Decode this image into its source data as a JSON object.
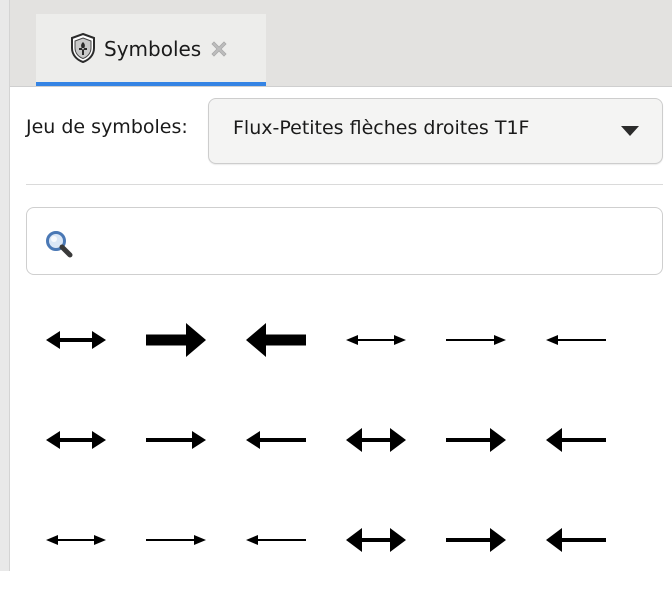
{
  "tab": {
    "label": "Symboles",
    "icon": "shield-icon",
    "close_icon": "close-icon",
    "accent_color": "#3584e4"
  },
  "symbol_set": {
    "label": "Jeu de symboles:",
    "selected": "Flux-Petites flèches droites T1F"
  },
  "search": {
    "value": "",
    "placeholder": "",
    "icon": "search-icon"
  },
  "symbols": [
    {
      "icon": "double-arrow-icon",
      "style": "bold"
    },
    {
      "icon": "arrow-right-icon",
      "style": "heavy"
    },
    {
      "icon": "arrow-left-icon",
      "style": "heavy"
    },
    {
      "icon": "double-arrow-icon",
      "style": "thin"
    },
    {
      "icon": "arrow-right-icon",
      "style": "thin"
    },
    {
      "icon": "arrow-left-icon",
      "style": "thin"
    },
    {
      "icon": "double-arrow-icon",
      "style": "bold"
    },
    {
      "icon": "arrow-right-icon",
      "style": "bold"
    },
    {
      "icon": "arrow-left-icon",
      "style": "bold"
    },
    {
      "icon": "double-arrow-icon",
      "style": "wide"
    },
    {
      "icon": "arrow-right-icon",
      "style": "wide"
    },
    {
      "icon": "arrow-left-icon",
      "style": "wide"
    },
    {
      "icon": "double-arrow-icon",
      "style": "thin"
    },
    {
      "icon": "arrow-right-icon",
      "style": "thin"
    },
    {
      "icon": "arrow-left-icon",
      "style": "thin"
    },
    {
      "icon": "double-arrow-icon",
      "style": "wide"
    },
    {
      "icon": "arrow-right-icon",
      "style": "wide"
    },
    {
      "icon": "arrow-left-icon",
      "style": "wide"
    }
  ]
}
